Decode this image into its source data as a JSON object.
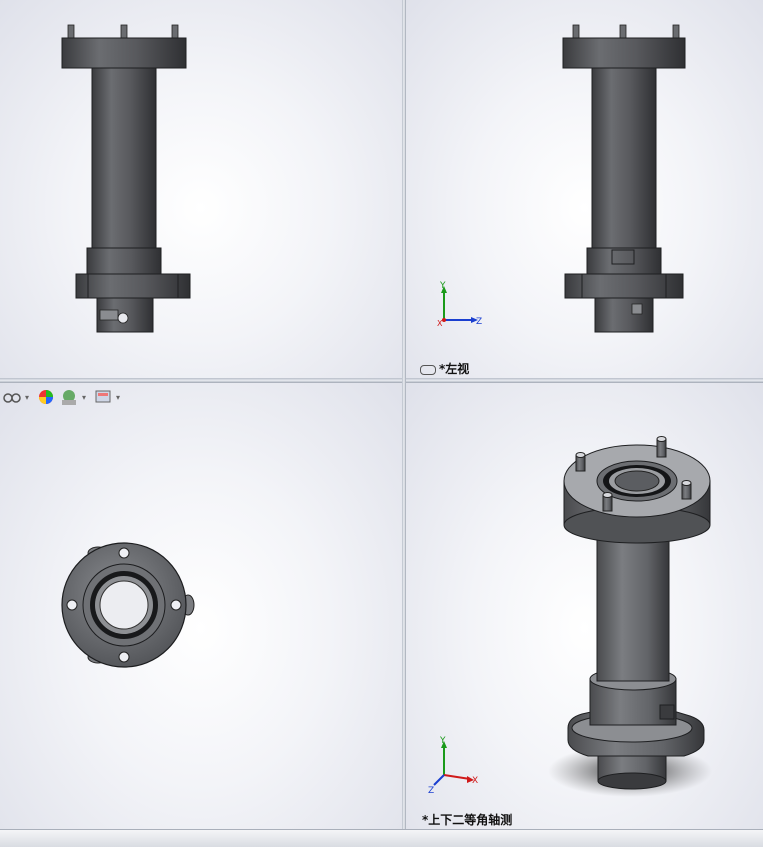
{
  "viewports": {
    "top_left": {
      "name": "front-view",
      "label": ""
    },
    "top_right": {
      "name": "left-view",
      "label": "*左视"
    },
    "bottom_left": {
      "name": "bottom-view",
      "label": ""
    },
    "bottom_right": {
      "name": "dimetric-view",
      "label": "*上下二等角轴测"
    }
  },
  "triad": {
    "left_view": {
      "y": "Y",
      "z": "Z",
      "x": "X"
    },
    "dimetric": {
      "y": "Y",
      "z": "Z",
      "x": "X"
    }
  },
  "heads_up_toolbar": {
    "icons": [
      "view-display-style-icon",
      "appearance-icon",
      "scene-icon",
      "display-manager-icon"
    ]
  },
  "colors": {
    "part_body": "#5b5d61",
    "part_light": "#7a7c80",
    "part_dark": "#2c2d30",
    "axis_y": "#1a9a1a",
    "axis_z": "#1a3fd0",
    "axis_x": "#d01a1a"
  }
}
